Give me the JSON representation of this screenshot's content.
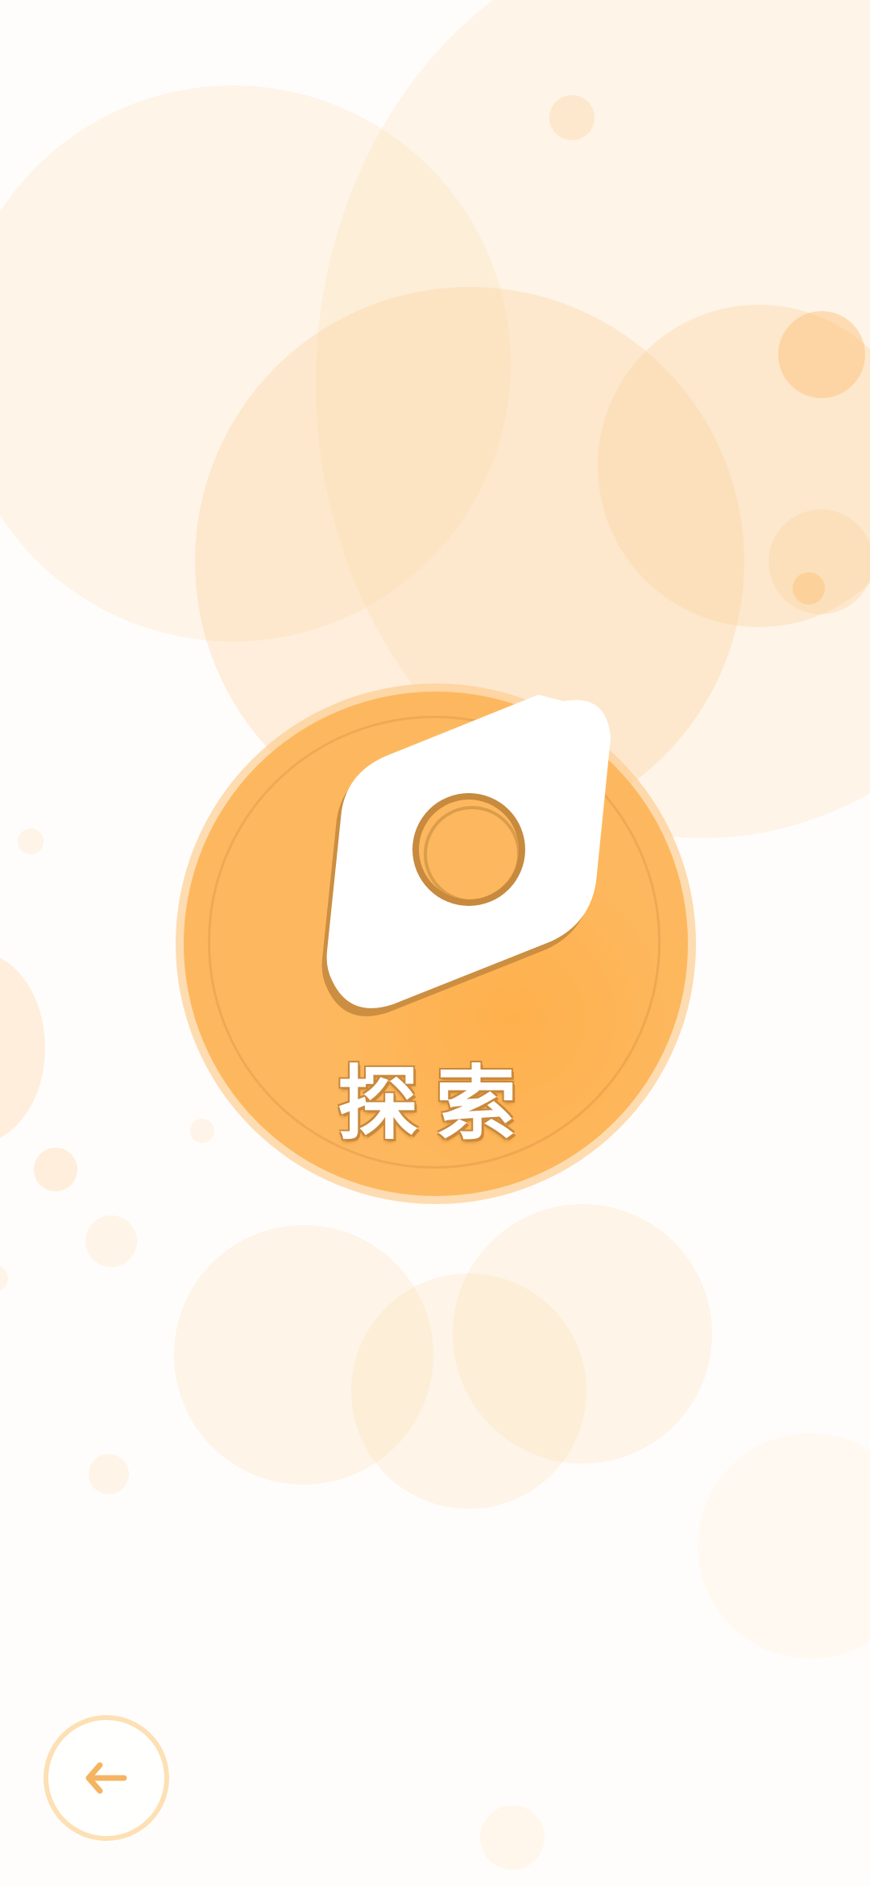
{
  "explore": {
    "label": "探索",
    "icon": "compass-icon"
  },
  "back": {
    "icon": "back-arrow-icon"
  },
  "colors": {
    "accent": "#fdb85f",
    "accent_dark": "#c9883b",
    "ring": "#fde0b3",
    "bubble": "#fdd5a0"
  }
}
